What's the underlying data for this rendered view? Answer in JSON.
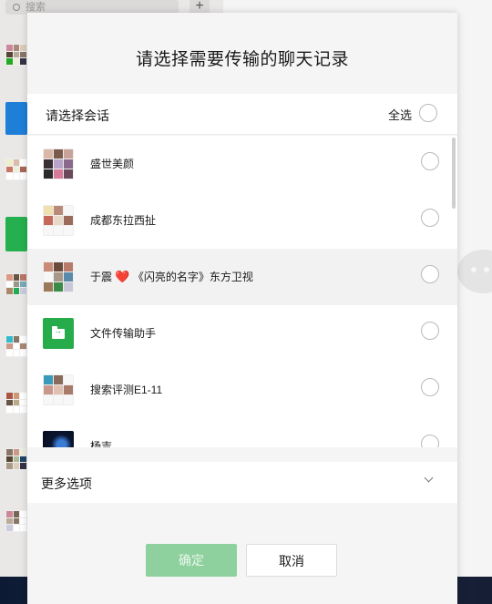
{
  "app": {
    "search_placeholder": "搜索",
    "add_button": "+"
  },
  "dialog": {
    "title": "请选择需要传输的聊天记录",
    "select_label": "请选择会话",
    "select_all_label": "全选",
    "conversations": [
      {
        "name": "盛世美颜",
        "avatar": "group-avatar"
      },
      {
        "name": "成都东拉西扯",
        "avatar": "group-avatar"
      },
      {
        "name_prefix": "于震",
        "heart": "❤️",
        "name_suffix": "《闪亮的名字》东方卫视",
        "avatar": "group-avatar"
      },
      {
        "name": "文件传输助手",
        "avatar": "file-transfer-icon"
      },
      {
        "name": "搜索评测E1-11",
        "avatar": "group-avatar"
      },
      {
        "name": "杨吉",
        "avatar": "photo-avatar"
      }
    ],
    "more_options_label": "更多选项",
    "confirm_label": "确定",
    "cancel_label": "取消"
  },
  "colors": {
    "accent_green": "#27ac4b",
    "confirm_disabled": "#8fd19e"
  }
}
